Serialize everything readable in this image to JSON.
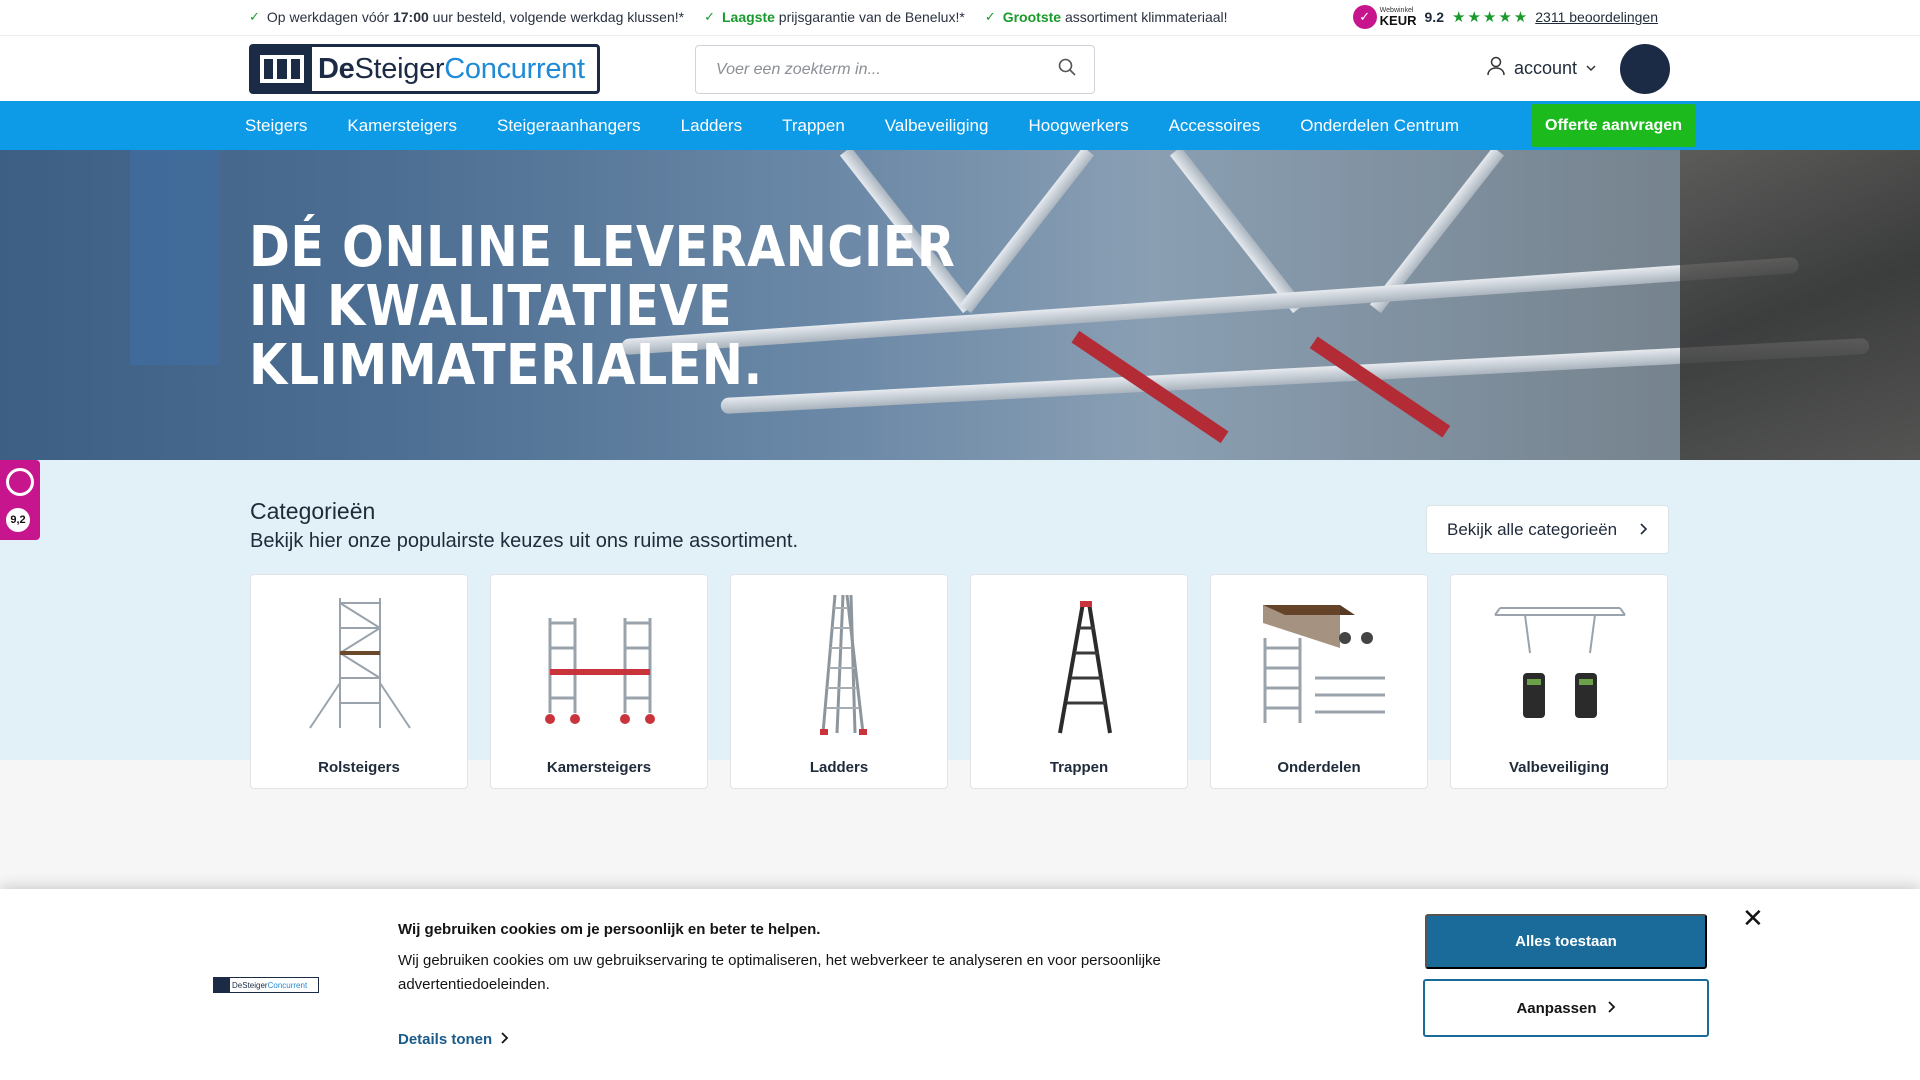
{
  "usp": [
    {
      "before": "Op werkdagen vóór ",
      "highlight": "17:00",
      "after": " uur besteld, volgende werkdag klussen!*"
    },
    {
      "before": "",
      "highlight": "Laagste",
      "after": " prijsgarantie van de Benelux!*"
    },
    {
      "before": "",
      "highlight": "Grootste",
      "after": " assortiment klimmateriaal!"
    }
  ],
  "rating": {
    "keur_small": "Webwinkel",
    "keur_big": "KEUR",
    "score": "9.2",
    "stars": 5,
    "reviews": "2311 beoordelingen"
  },
  "header": {
    "logo": {
      "de": "De",
      "steiger": "Steiger",
      "concurrent": "Concurrent"
    },
    "search_placeholder": "Voer een zoekterm in...",
    "account_label": "account"
  },
  "nav": {
    "items": [
      "Steigers",
      "Kamersteigers",
      "Steigeraanhangers",
      "Ladders",
      "Trappen",
      "Valbeveiliging",
      "Hoogwerkers",
      "Accessoires",
      "Onderdelen Centrum"
    ],
    "cta": "Offerte aanvragen"
  },
  "hero": {
    "title": "DÉ ONLINE LEVERANCIER\nIN KWALITATIEVE\nKLIMMATERIALEN."
  },
  "categories": {
    "title": "Categorieën",
    "subtitle": "Bekijk hier onze populairste keuzes uit ons ruime assortiment.",
    "all_button": "Bekijk alle categorieën",
    "items": [
      {
        "name": "Rolsteigers",
        "icon": "rolsteiger-image"
      },
      {
        "name": "Kamersteigers",
        "icon": "kamersteiger-image"
      },
      {
        "name": "Ladders",
        "icon": "ladder-image"
      },
      {
        "name": "Trappen",
        "icon": "trap-image"
      },
      {
        "name": "Onderdelen",
        "icon": "onderdelen-image"
      },
      {
        "name": "Valbeveiliging",
        "icon": "valbeveiliging-image"
      }
    ]
  },
  "side_badge": {
    "score": "9,2"
  },
  "cookie": {
    "title": "Wij gebruiken cookies om je persoonlijk en beter te helpen.",
    "text": "Wij gebruiken cookies om uw gebruikservaring te optimaliseren, het webverkeer te analyseren en voor persoonlijke advertentiedoeleinden.",
    "details": "Details tonen",
    "allow_all": "Alles toestaan",
    "customize": "Aanpassen",
    "close": "✕"
  },
  "colors": {
    "nav_blue": "#0d9ae6",
    "brand_navy": "#1c2b45",
    "cta_green": "#1dba1d",
    "check_green": "#1a9a2c",
    "cookie_blue": "#1a6b9a",
    "keur_pink": "#c7168d"
  }
}
